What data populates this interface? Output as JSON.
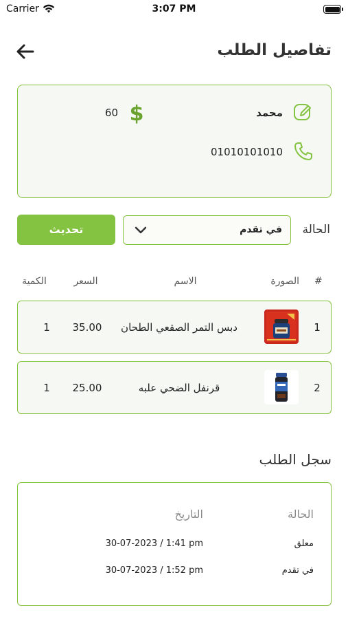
{
  "status_bar": {
    "carrier": "Carrier",
    "time": "3:07 PM"
  },
  "header": {
    "title": "تفاصيل الطلب",
    "back_icon": "arrow-left-icon"
  },
  "customer": {
    "name": "محمد",
    "phone": "01010101010",
    "total": "60",
    "icons": {
      "name": "edit-icon",
      "phone": "phone-icon",
      "total": "dollar-icon"
    }
  },
  "status_control": {
    "label": "الحالة",
    "selected": "في تقدم",
    "update_button": "تحديث"
  },
  "items_table": {
    "headers": {
      "number": "#",
      "image": "الصورة",
      "name": "الاسم",
      "price": "السعر",
      "quantity": "الكمية"
    },
    "rows": [
      {
        "number": "1",
        "name": "دبس التمر الصقعي الطحان",
        "price": "35.00",
        "quantity": "1"
      },
      {
        "number": "2",
        "name": "قرنفل الضحي علبه",
        "price": "25.00",
        "quantity": "1"
      }
    ]
  },
  "history": {
    "title": "سجل الطلب",
    "headers": {
      "status": "الحالة",
      "date": "التاريخ"
    },
    "rows": [
      {
        "status": "معلق",
        "date": "30-07-2023 / 1:41 pm"
      },
      {
        "status": "في تقدم",
        "date": "30-07-2023 / 1:52 pm"
      }
    ]
  },
  "colors": {
    "accent": "#84c341",
    "border": "#86c13f",
    "card_bg": "#f6f8f3"
  }
}
